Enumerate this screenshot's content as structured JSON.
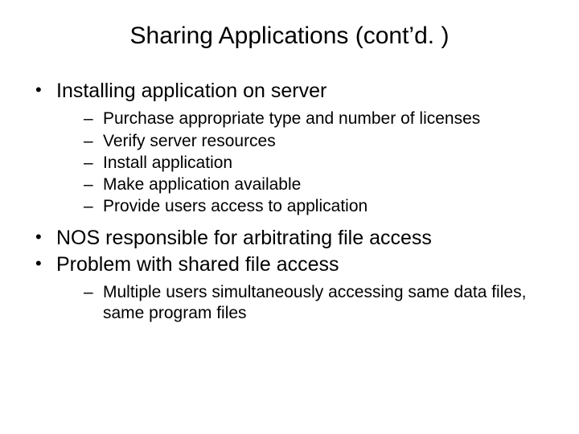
{
  "title": "Sharing Applications (cont’d. )",
  "bullets": [
    {
      "text": "Installing application on server",
      "sub": [
        "Purchase appropriate type and number of licenses",
        "Verify server resources",
        "Install application",
        "Make application available",
        "Provide users access to application"
      ]
    },
    {
      "text": "NOS responsible for arbitrating file access",
      "sub": []
    },
    {
      "text": "Problem with shared file access",
      "sub": [
        "Multiple users simultaneously accessing same data files, same program files"
      ]
    }
  ]
}
